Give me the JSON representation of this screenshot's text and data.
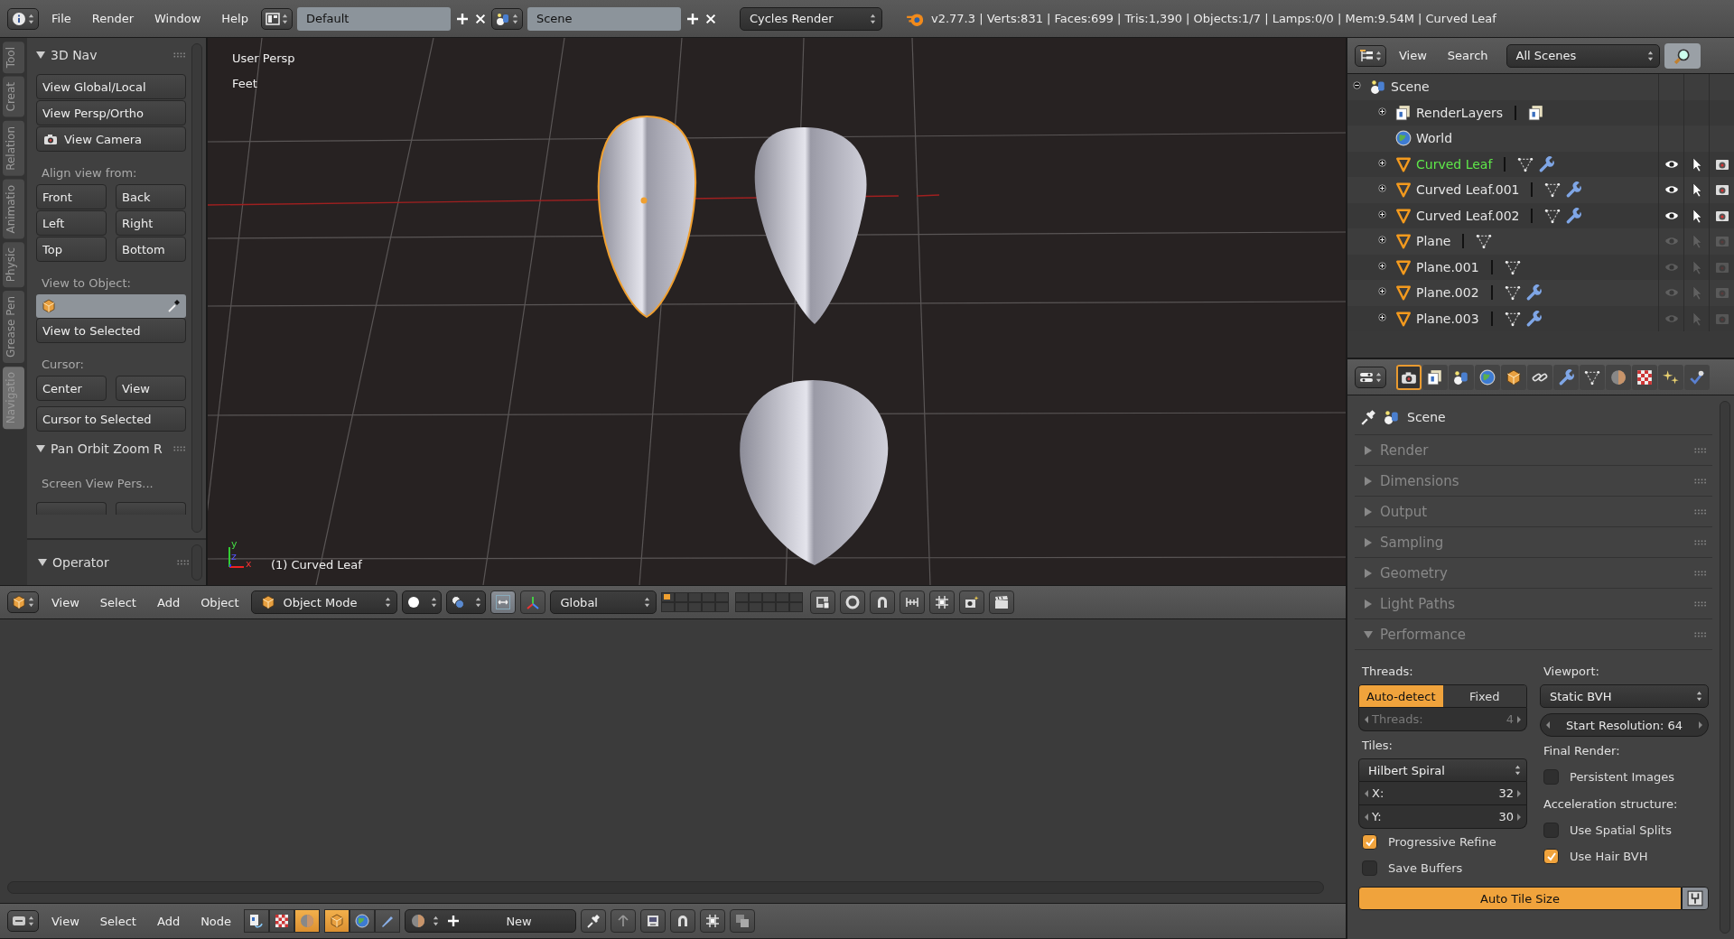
{
  "top_bar": {
    "menus": [
      "File",
      "Render",
      "Window",
      "Help"
    ],
    "layout": "Default",
    "scene": "Scene",
    "engine": "Cycles Render",
    "stats": "v2.77.3 | Verts:831 | Faces:699 | Tris:1,390 | Objects:1/7 | Lamps:0/0 | Mem:9.54M | Curved Leaf"
  },
  "tool_tabs": [
    {
      "label": "Tool",
      "selected": false
    },
    {
      "label": "Creat",
      "selected": false
    },
    {
      "label": "Relation",
      "selected": false
    },
    {
      "label": "Animatio",
      "selected": false
    },
    {
      "label": "Physic",
      "selected": false
    },
    {
      "label": "Grease Pen",
      "selected": false
    },
    {
      "label": "Navigatio",
      "selected": true
    }
  ],
  "tool_panel": {
    "rows": [
      {
        "kind": "header",
        "label": "3D Nav",
        "expanded": true
      },
      {
        "kind": "stack",
        "buttons": [
          {
            "kind": "text",
            "label": "View Global/Local"
          },
          {
            "kind": "text",
            "label": "View Persp/Ortho"
          },
          {
            "kind": "camera",
            "label": "View Camera"
          }
        ]
      },
      {
        "kind": "label",
        "label": "Align view from:"
      },
      {
        "kind": "grid",
        "buttons": [
          "Front",
          "Back",
          "Left",
          "Right",
          "Top",
          "Bottom"
        ]
      },
      {
        "kind": "label",
        "label": "View to Object:"
      },
      {
        "kind": "object_field"
      },
      {
        "kind": "button",
        "label": "View to Selected"
      },
      {
        "kind": "label",
        "label": "Cursor:"
      },
      {
        "kind": "grid",
        "buttons": [
          "Center",
          "View"
        ]
      },
      {
        "kind": "button",
        "label": "Cursor to Selected"
      },
      {
        "kind": "header",
        "label": "Pan Orbit Zoom R",
        "expanded": true
      },
      {
        "kind": "label",
        "label": "Screen View Pers..."
      },
      {
        "kind": "partial"
      }
    ]
  },
  "operator_panel": {
    "title": "Operator",
    "expanded": true
  },
  "viewport": {
    "view_name": "User Persp",
    "units": "Feet",
    "object_label": "(1) Curved Leaf",
    "axis_labels": [
      "y",
      "z",
      "x"
    ],
    "objects": [
      {
        "selected": true
      },
      {
        "selected": false
      },
      {
        "selected": false
      }
    ]
  },
  "view3d_header": {
    "menus": [
      "View",
      "Select",
      "Add",
      "Object"
    ],
    "mode": "Object Mode",
    "orientation": "Global"
  },
  "node_header": {
    "menus": [
      "View",
      "Select",
      "Add",
      "Node"
    ],
    "new_button": "New"
  },
  "outliner": {
    "menus": [
      "View",
      "Search"
    ],
    "display": "All Scenes",
    "tree": [
      {
        "kind": "scene",
        "label": "Scene",
        "expanded": true,
        "children": [
          {
            "kind": "renderlayers",
            "label": "RenderLayers",
            "expanded": false
          },
          {
            "kind": "world",
            "label": "World"
          },
          {
            "kind": "object",
            "label": "Curved Leaf",
            "expanded": false,
            "active": true,
            "modifier": true,
            "visible": true
          },
          {
            "kind": "object",
            "label": "Curved Leaf.001",
            "expanded": false,
            "active": false,
            "modifier": true,
            "visible": true
          },
          {
            "kind": "object",
            "label": "Curved Leaf.002",
            "expanded": false,
            "active": false,
            "modifier": true,
            "visible": true
          },
          {
            "kind": "object",
            "label": "Plane",
            "expanded": false,
            "active": false,
            "modifier": false,
            "visible": false
          },
          {
            "kind": "object",
            "label": "Plane.001",
            "expanded": false,
            "active": false,
            "modifier": false,
            "visible": false
          },
          {
            "kind": "object",
            "label": "Plane.002",
            "expanded": false,
            "active": false,
            "modifier": true,
            "visible": false
          },
          {
            "kind": "object",
            "label": "Plane.003",
            "expanded": false,
            "active": false,
            "modifier": true,
            "visible": false
          }
        ]
      }
    ]
  },
  "properties": {
    "tabs": [
      {
        "kind": "render",
        "selected": true
      },
      {
        "kind": "layers",
        "selected": false
      },
      {
        "kind": "scene",
        "selected": false
      },
      {
        "kind": "world",
        "selected": false
      },
      {
        "kind": "object",
        "selected": false
      },
      {
        "kind": "constraints",
        "selected": false
      },
      {
        "kind": "modifiers",
        "selected": false
      },
      {
        "kind": "data",
        "selected": false
      },
      {
        "kind": "material",
        "selected": false
      },
      {
        "kind": "texture",
        "selected": false
      },
      {
        "kind": "particles",
        "selected": false
      },
      {
        "kind": "physics",
        "selected": false
      }
    ],
    "context": "Scene",
    "panels": [
      {
        "title": "Render",
        "expanded": false
      },
      {
        "title": "Dimensions",
        "expanded": false
      },
      {
        "title": "Output",
        "expanded": false
      },
      {
        "title": "Sampling",
        "expanded": false
      },
      {
        "title": "Geometry",
        "expanded": false
      },
      {
        "title": "Light Paths",
        "expanded": false
      },
      {
        "title": "Performance",
        "expanded": true
      }
    ],
    "performance": {
      "threads_label": "Threads:",
      "thread_modes": [
        {
          "label": "Auto-detect",
          "selected": true
        },
        {
          "label": "Fixed",
          "selected": false
        }
      ],
      "threads_field": {
        "label": "Threads:",
        "value": "4",
        "disabled": true
      },
      "tiles_label": "Tiles:",
      "tile_order": "Hilbert Spiral",
      "tile_x": {
        "label": "X:",
        "value": "32"
      },
      "tile_y": {
        "label": "Y:",
        "value": "30"
      },
      "left_checks": [
        {
          "label": "Progressive Refine",
          "checked": true
        },
        {
          "label": "Save Buffers",
          "checked": false
        }
      ],
      "viewport_label": "Viewport:",
      "bvh": "Static BVH",
      "start_resolution": "Start Resolution: 64",
      "final_label": "Final Render:",
      "final_checks": [
        {
          "label": "Persistent Images",
          "checked": false
        }
      ],
      "accel_label": "Acceleration structure:",
      "accel_checks": [
        {
          "label": "Use Spatial Splits",
          "checked": false
        },
        {
          "label": "Use Hair BVH",
          "checked": true
        }
      ],
      "auto_tile": {
        "label": "Auto Tile Size",
        "on": true
      }
    }
  }
}
